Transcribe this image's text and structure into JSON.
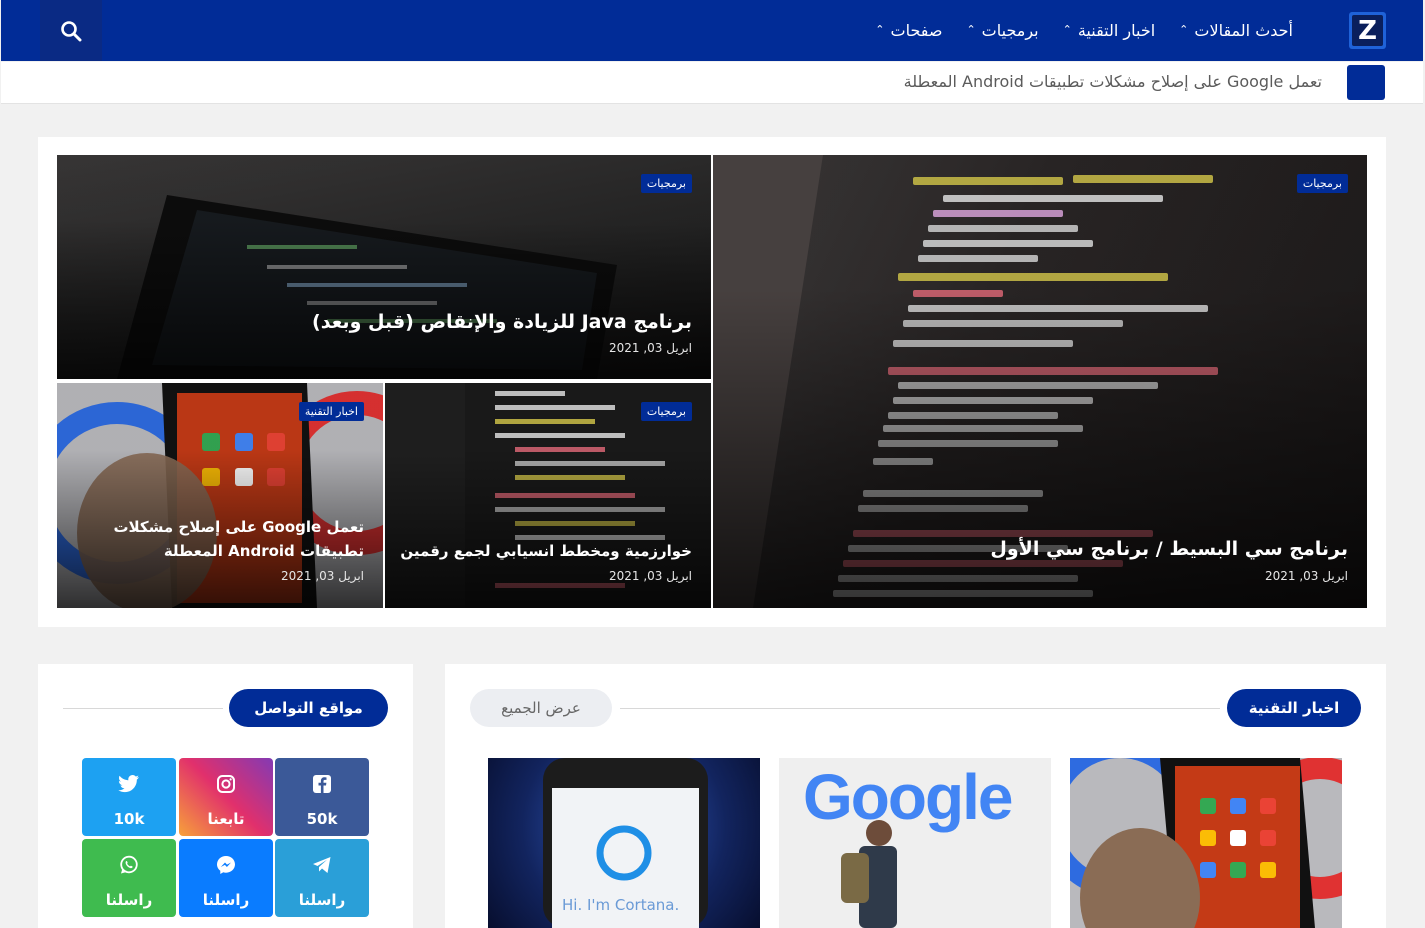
{
  "logo_letter": "Z",
  "nav": {
    "items": [
      {
        "label": "أحدث المقالات"
      },
      {
        "label": "اخبار التقنية"
      },
      {
        "label": "برمجيات"
      },
      {
        "label": "صفحات"
      }
    ]
  },
  "ticker": {
    "text": "تعمل Google على إصلاح مشكلات تطبيقات Android المعطلة"
  },
  "hero": {
    "main": {
      "badge": "برمجيات",
      "title": "برنامج سي البسيط / برنامج سي الأول",
      "date": "ابريل 03, 2021"
    },
    "top": {
      "badge": "برمجيات",
      "title": "برنامج Java للزيادة والإنقاص (قبل وبعد)",
      "date": "ابريل 03, 2021"
    },
    "bottom_right": {
      "badge": "برمجيات",
      "title": "خوارزمية ومخطط انسيابي لجمع رقمين",
      "date": "ابريل 03, 2021"
    },
    "bottom_left": {
      "badge": "اخبار التقنية",
      "title": "تعمل Google على إصلاح مشكلات تطبيقات Android المعطلة",
      "date": "ابريل 03, 2021"
    }
  },
  "tech_section": {
    "title": "اخبار التقنية",
    "view_all": "عرض الجميع",
    "thumbs": [
      {
        "text": "Google"
      },
      {
        "text": "Hi. I'm Cortana."
      }
    ]
  },
  "social_section": {
    "title": "مواقع التواصل",
    "items": [
      {
        "network": "facebook",
        "label": "50k",
        "color": "#3b5998"
      },
      {
        "network": "instagram",
        "label": "تابعنا",
        "color": "#c13584"
      },
      {
        "network": "twitter",
        "label": "10k",
        "color": "#1da1f2"
      },
      {
        "network": "telegram",
        "label": "راسلنا",
        "color": "#2a9fd8"
      },
      {
        "network": "messenger",
        "label": "راسلنا",
        "color": "#0a7cff"
      },
      {
        "network": "whatsapp",
        "label": "راسلنا",
        "color": "#3fbb4f"
      }
    ]
  },
  "colors": {
    "brand": "#012c97",
    "background": "#f1f1f1"
  }
}
